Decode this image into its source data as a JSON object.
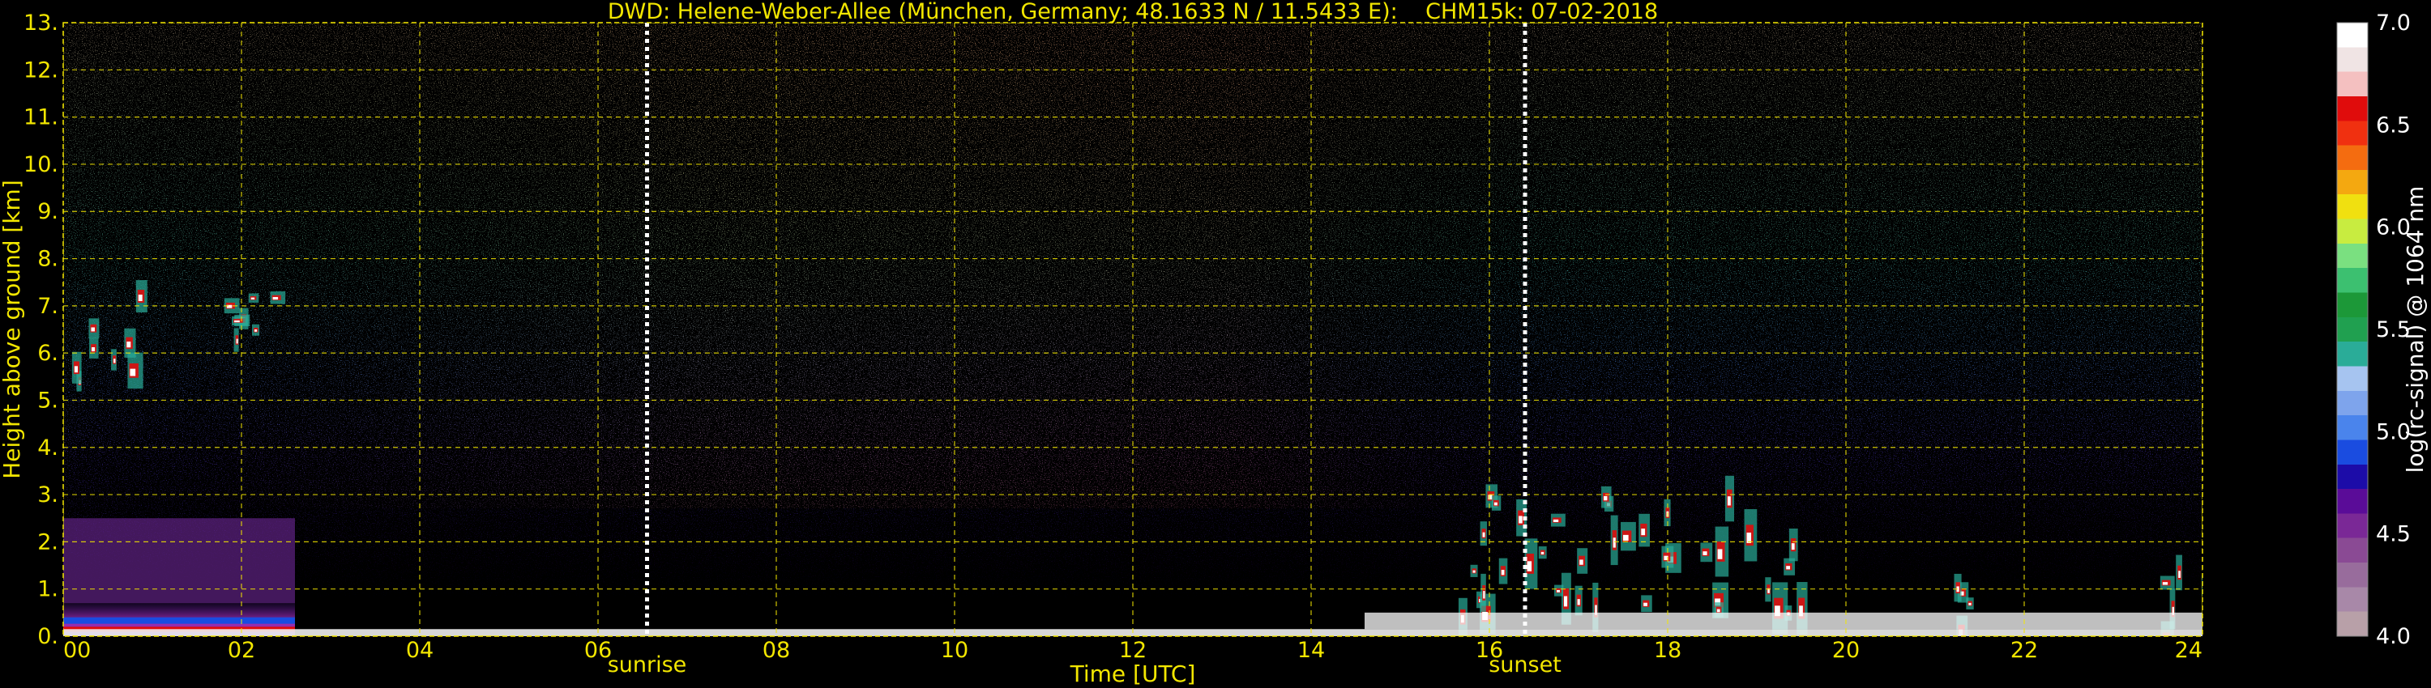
{
  "chart_data": {
    "type": "heatmap",
    "title": "DWD: Helene-Weber-Allee (München, Germany; 48.1633 N / 11.5433 E):    CHM15k: 07-02-2018",
    "xlabel": "Time [UTC]",
    "ylabel": "Height above ground [km]",
    "xlim": [
      0,
      24
    ],
    "ylim": [
      0,
      13
    ],
    "x_ticks": [
      "00",
      "02",
      "04",
      "06",
      "08",
      "10",
      "12",
      "14",
      "16",
      "18",
      "20",
      "22",
      "24"
    ],
    "y_ticks": [
      "0.",
      "1.",
      "2.",
      "3.",
      "4.",
      "5.",
      "6.",
      "7.",
      "8.",
      "9.",
      "10.",
      "11.",
      "12.",
      "13."
    ],
    "grid": true,
    "annotations": [
      {
        "label": "sunrise",
        "x": 6.55
      },
      {
        "label": "sunset",
        "x": 16.4
      }
    ],
    "colorbar": {
      "label": "log(rc-signal) @ 1064 nm",
      "range": [
        4.0,
        7.0
      ],
      "ticks": [
        "4.0",
        "4.5",
        "5.0",
        "5.5",
        "6.0",
        "6.5",
        "7.0"
      ],
      "colors": [
        "#b8a0a8",
        "#a888a8",
        "#986c9c",
        "#8a4a94",
        "#7a2896",
        "#5a0c98",
        "#1c0ca8",
        "#1a4ce0",
        "#4a84ec",
        "#7ea4ec",
        "#a6c4f0",
        "#2aac98",
        "#20a050",
        "#1c9838",
        "#3cc070",
        "#7ae080",
        "#c8ec40",
        "#f0e010",
        "#f4a810",
        "#f46c10",
        "#f03010",
        "#e00c0c",
        "#f4c0c0",
        "#f0e4e4",
        "#ffffff"
      ]
    },
    "features": [
      {
        "name": "boundary-layer",
        "x": [
          0,
          2.6
        ],
        "y": [
          0,
          0.7
        ]
      },
      {
        "name": "cloud",
        "x": [
          0,
          0.9
        ],
        "y": [
          5.3,
          7.6
        ]
      },
      {
        "name": "cloud",
        "x": [
          1.7,
          2.6
        ],
        "y": [
          6.3,
          7.5
        ]
      },
      {
        "name": "cloud",
        "x": [
          15.3,
          19.6
        ],
        "y": [
          0.6,
          3.4
        ]
      },
      {
        "name": "cloud",
        "x": [
          21.2,
          21.4
        ],
        "y": [
          0.3,
          1.8
        ]
      },
      {
        "name": "cloud",
        "x": [
          23.5,
          24
        ],
        "y": [
          0.3,
          2.6
        ]
      }
    ]
  }
}
